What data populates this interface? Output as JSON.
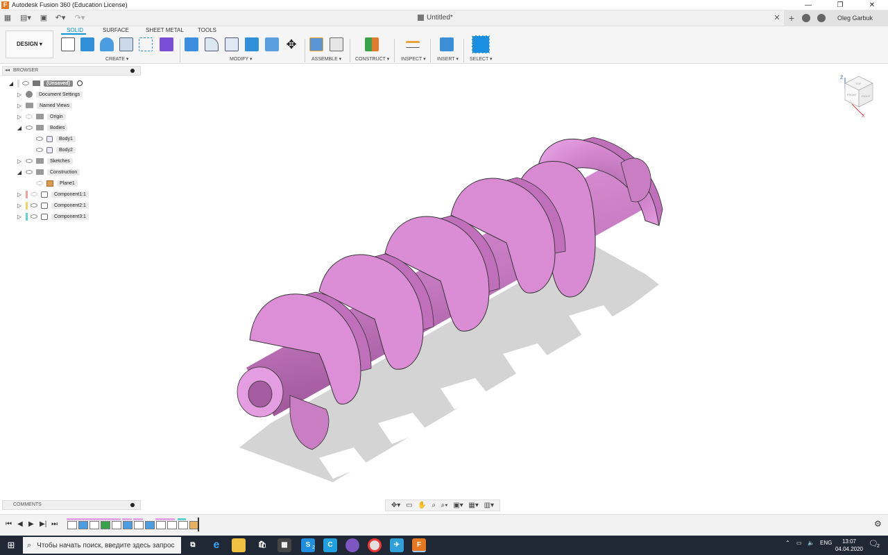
{
  "window": {
    "title": "Autodesk Fusion 360 (Education License)",
    "app_icon": "F",
    "minimize": "—",
    "maximize": "❐",
    "close": "✕"
  },
  "tabbar": {
    "doc_title": "Untitled*",
    "user": "Oleg Garbuk"
  },
  "toolbar": {
    "workspace": "DESIGN ▾",
    "tabs": [
      "SOLID",
      "SURFACE",
      "SHEET METAL",
      "TOOLS"
    ],
    "groups": {
      "create": "CREATE ▾",
      "modify": "MODIFY ▾",
      "assemble": "ASSEMBLE ▾",
      "construct": "CONSTRUCT ▾",
      "inspect": "INSPECT ▾",
      "insert": "INSERT ▾",
      "select": "SELECT ▾"
    }
  },
  "browser": {
    "title": "BROWSER",
    "collapse": "◂◂",
    "items": [
      {
        "label": "(Unsaved)"
      },
      {
        "label": "Document Settings"
      },
      {
        "label": "Named Views"
      },
      {
        "label": "Origin"
      },
      {
        "label": "Bodies"
      },
      {
        "label": "Body1"
      },
      {
        "label": "Body2"
      },
      {
        "label": "Sketches"
      },
      {
        "label": "Construction"
      },
      {
        "label": "Plane1"
      },
      {
        "label": "Component1:1"
      },
      {
        "label": "Component2:1"
      },
      {
        "label": "Component3:1"
      }
    ]
  },
  "viewcube": {
    "z": "Z",
    "x": "X",
    "top": "TOP",
    "front": "FRONT",
    "right": "RIGHT"
  },
  "comments": {
    "title": "COMMENTS"
  },
  "taskbar": {
    "search_placeholder": "Чтобы начать поиск, введите здесь запрос",
    "lang": "ENG",
    "time": "13:07",
    "date": "04.04.2020",
    "notif_count": "2",
    "skype_badge": "2"
  },
  "colors": {
    "accent": "#0696d7",
    "model": "#d887d3",
    "taskbar": "#1f2834"
  }
}
